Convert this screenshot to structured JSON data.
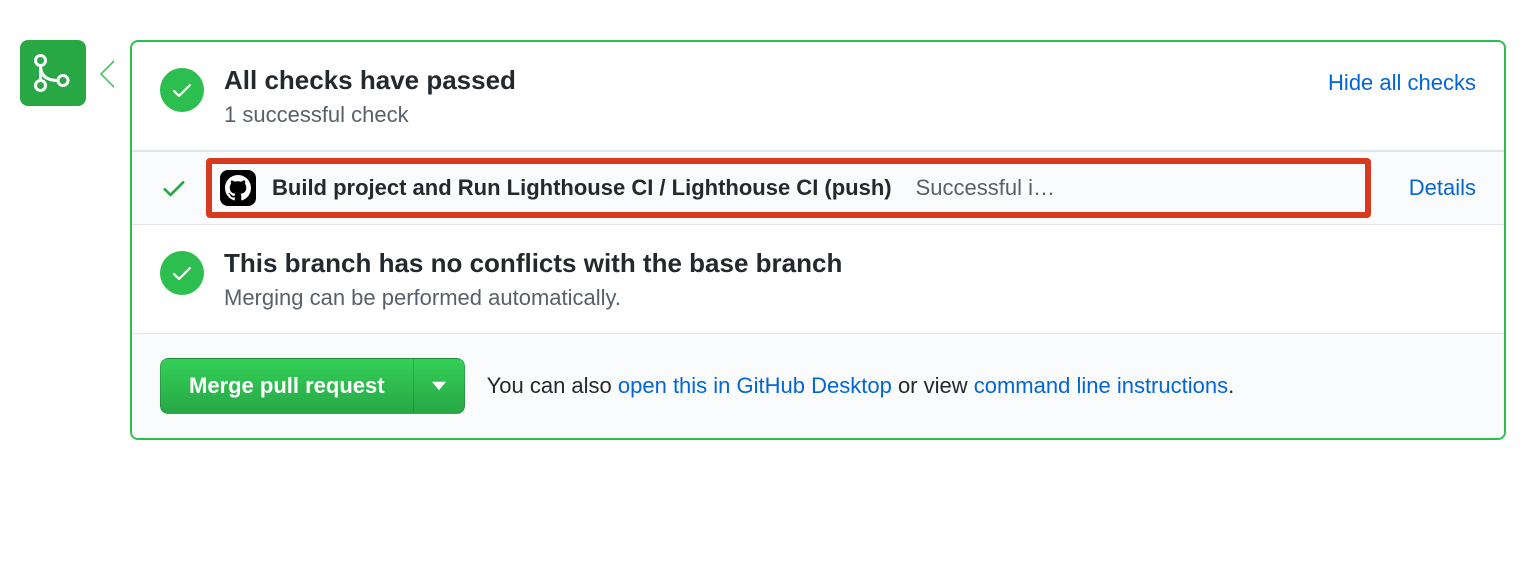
{
  "checks_summary": {
    "title": "All checks have passed",
    "subtitle": "1 successful check",
    "toggle_label": "Hide all checks"
  },
  "check_item": {
    "name": "Build project and Run Lighthouse CI / Lighthouse CI (push)",
    "status": "Successful i…",
    "details_label": "Details"
  },
  "conflicts": {
    "title": "This branch has no conflicts with the base branch",
    "subtitle": "Merging can be performed automatically."
  },
  "merge": {
    "button_label": "Merge pull request",
    "hint_prefix": "You can also ",
    "desktop_link": "open this in GitHub Desktop",
    "hint_middle": " or view ",
    "cli_link": "command line instructions",
    "hint_suffix": "."
  }
}
